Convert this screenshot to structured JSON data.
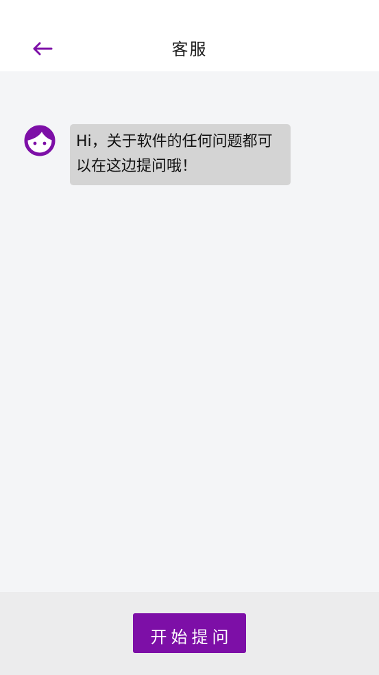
{
  "header": {
    "title": "客服",
    "back_icon": "arrow-left-icon"
  },
  "chat": {
    "messages": [
      {
        "sender": "agent",
        "avatar_icon": "face-icon",
        "text": "Hi，关于软件的任何问题都可以在这边提问哦！"
      }
    ]
  },
  "footer": {
    "ask_button_label": "开始提问"
  },
  "colors": {
    "accent": "#7d0fa7",
    "background": "#f4f5f7",
    "bubble": "#d4d4d4",
    "footer": "#ececed"
  }
}
